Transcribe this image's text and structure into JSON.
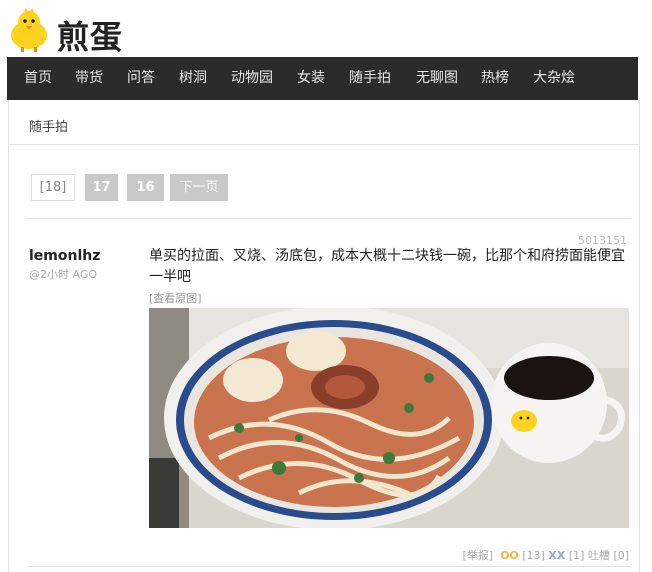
{
  "site": {
    "brand": "煎蛋"
  },
  "nav": [
    "首页",
    "带货",
    "问答",
    "树洞",
    "动物园",
    "女装",
    "随手拍",
    "无聊图",
    "热榜",
    "大杂烩"
  ],
  "breadcrumb": "随手拍",
  "pagination": {
    "current": "[18]",
    "pages": [
      "17",
      "16"
    ],
    "next": "下一页"
  },
  "post": {
    "id": "5013151",
    "author": "lemonlhz",
    "time": "@2小时 AGO",
    "text": "单买的拉面、叉烧、汤底包，成本大概十二块钱一碗，比那个和府捞面能便宜一半吧",
    "view_original": "[查看原图]",
    "report": "[举报]",
    "oo_label": "OO",
    "oo_count": "[13]",
    "xx_label": "XX",
    "xx_count": "[1]",
    "comments": "吐槽 [0]"
  },
  "colors": {
    "nav_bg": "#2b2b2b",
    "page_btn": "#c9c9c9",
    "oo": "#f5b342",
    "xx": "#8fa8d9",
    "chick": "#ffd21f"
  },
  "icons": [
    "chick-logo-icon"
  ]
}
